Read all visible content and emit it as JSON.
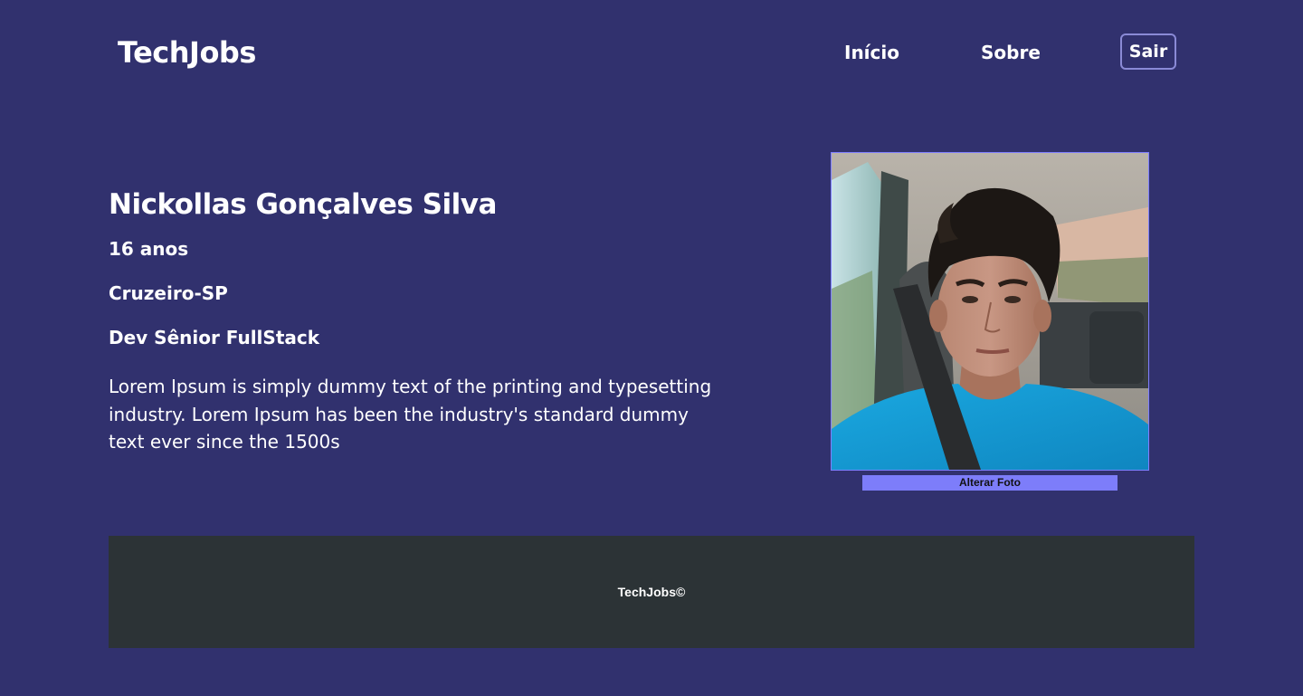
{
  "header": {
    "logo": "TechJobs",
    "nav": {
      "home": "Início",
      "about": "Sobre",
      "logout": "Sair"
    }
  },
  "profile": {
    "name": "Nickollas Gonçalves Silva",
    "age": "16 anos",
    "city": "Cruzeiro-SP",
    "role": "Dev Sênior FullStack",
    "bio": "Lorem Ipsum is simply dummy text of the printing and typesetting industry. Lorem Ipsum has been the industry's standard dummy text ever since the 1500s",
    "change_photo_label": "Alterar Foto"
  },
  "footer": {
    "text": "TechJobs©"
  },
  "colors": {
    "background": "#31316e",
    "footer_background": "#2c3336",
    "accent": "#7d7dfa",
    "button_border": "#8a8ad6"
  }
}
